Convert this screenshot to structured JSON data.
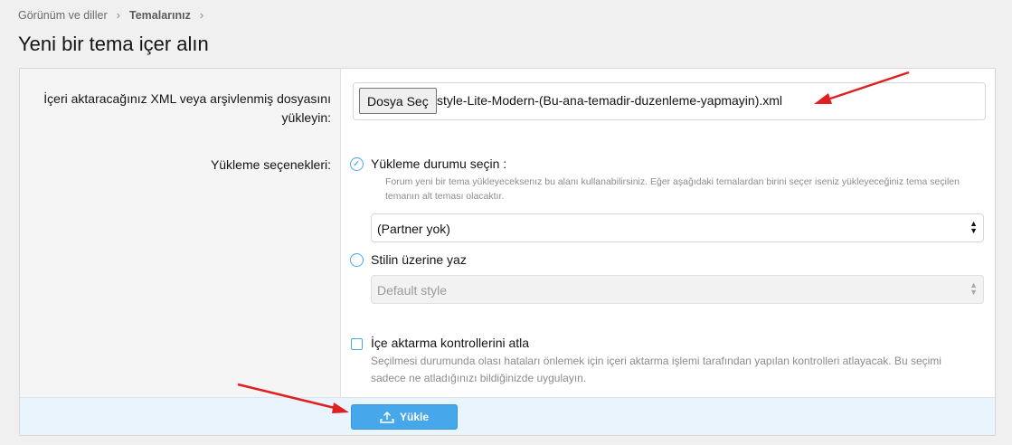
{
  "breadcrumb": {
    "item1": "Görünüm ve diller",
    "separator": "›",
    "item2": "Temalarınız"
  },
  "page_title": "Yeni bir tema içer alın",
  "import": {
    "label_line1": "İçeri aktaracağınız XML veya arşivlenmiş dosyasını",
    "label_line2": "yükleyin:",
    "file_button": "Dosya Seç",
    "file_name": "style-Lite-Modern-(Bu-ana-temadir-duzenleme-yapmayin).xml"
  },
  "options": {
    "label": "Yükleme seçenekleri:",
    "option1_label": "Yükleme durumu seçin :",
    "option1_hint_line1": "Forum yeni bir tema yükleyeceksenız bu alanı kullanabilirsiniz. Eğer aşağıdaki temalardan birini seçer iseniz yükleyeceğiniz tema seçilen",
    "option1_hint_line2": "temanın alt teması olacaktır.",
    "parent_select_value": "(Partner yok)",
    "option2_label": "Stilin üzerine yaz",
    "overwrite_select_value": "Default style",
    "skip_label": "İçe aktarma kontrollerini atla",
    "skip_hint_line1": "Seçilmesi durumunda olası hataları önlemek için içeri aktarma işlemi tarafından yapılan kontrolleri atlayacak. Bu seçimi",
    "skip_hint_line2": "sadece ne atladığınızı bildiğinizde uygulayın."
  },
  "submit_label": "Yükle",
  "icons": {
    "radio_selected": "check-icon",
    "submit": "upload-icon",
    "select": "updown-arrows-icon"
  },
  "colors": {
    "accent": "#47a7eb",
    "footer_bg": "#eaf4fc",
    "annotation_arrow": "#e02020"
  }
}
